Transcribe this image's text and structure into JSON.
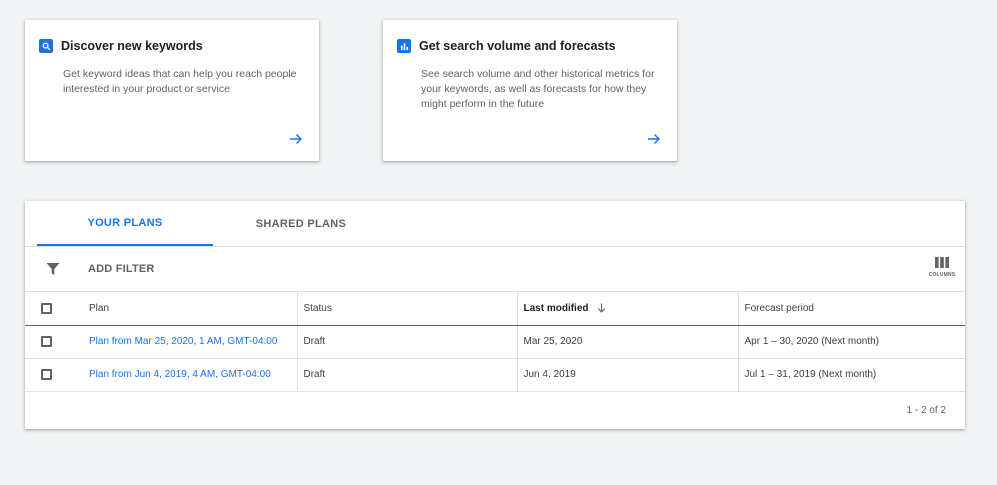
{
  "cards": [
    {
      "title": "Discover new keywords",
      "description": "Get keyword ideas that can help you reach people interested in your product or service",
      "icon": "search-icon"
    },
    {
      "title": "Get search volume and forecasts",
      "description": "See search volume and other historical metrics for your keywords, as well as forecasts for how they might perform in the future",
      "icon": "bar-chart-icon"
    }
  ],
  "tabs": {
    "your_plans": "YOUR PLANS",
    "shared_plans": "SHARED PLANS",
    "active": "your_plans"
  },
  "filter": {
    "add_filter_label": "ADD FILTER",
    "columns_label": "COLUMNS"
  },
  "table": {
    "headers": {
      "plan": "Plan",
      "status": "Status",
      "last_modified": "Last modified",
      "forecast_period": "Forecast period"
    },
    "rows": [
      {
        "plan": "Plan from Mar 25, 2020, 1 AM, GMT-04:00",
        "status": "Draft",
        "last_modified": "Mar 25, 2020",
        "forecast_period": "Apr 1 – 30, 2020 (Next month)"
      },
      {
        "plan": "Plan from Jun 4, 2019, 4 AM, GMT-04:00",
        "status": "Draft",
        "last_modified": "Jun 4, 2019",
        "forecast_period": "Jul 1 – 31, 2019 (Next month)"
      }
    ],
    "pagination": "1 - 2 of 2"
  },
  "colors": {
    "accent": "#1a73e8",
    "background": "#f1f3f4"
  }
}
